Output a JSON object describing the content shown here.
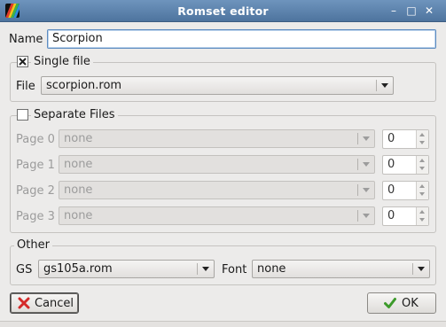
{
  "window": {
    "title": "Romset editor",
    "controls": [
      "–",
      "□",
      "✕"
    ]
  },
  "name_field": {
    "label": "Name",
    "value": "Scorpion"
  },
  "single_file": {
    "label": "Single file",
    "checked": true,
    "file_label": "File",
    "file_value": "scorpion.rom"
  },
  "separate_files": {
    "label": "Separate Files",
    "checked": false,
    "pages": [
      {
        "label": "Page 0",
        "value": "none",
        "number": "0"
      },
      {
        "label": "Page 1",
        "value": "none",
        "number": "0"
      },
      {
        "label": "Page 2",
        "value": "none",
        "number": "0"
      },
      {
        "label": "Page 3",
        "value": "none",
        "number": "0"
      }
    ]
  },
  "other": {
    "legend": "Other",
    "gs_label": "GS",
    "gs_value": "gs105a.rom",
    "font_label": "Font",
    "font_value": "none"
  },
  "buttons": {
    "cancel": {
      "label": "Cancel",
      "icon": "red-x-icon"
    },
    "ok": {
      "label": "OK",
      "icon": "green-check-icon"
    }
  },
  "colors": {
    "titlebar": "#5b81ab",
    "cancel_icon": "#d42a2a",
    "ok_icon": "#3c9a2a"
  }
}
